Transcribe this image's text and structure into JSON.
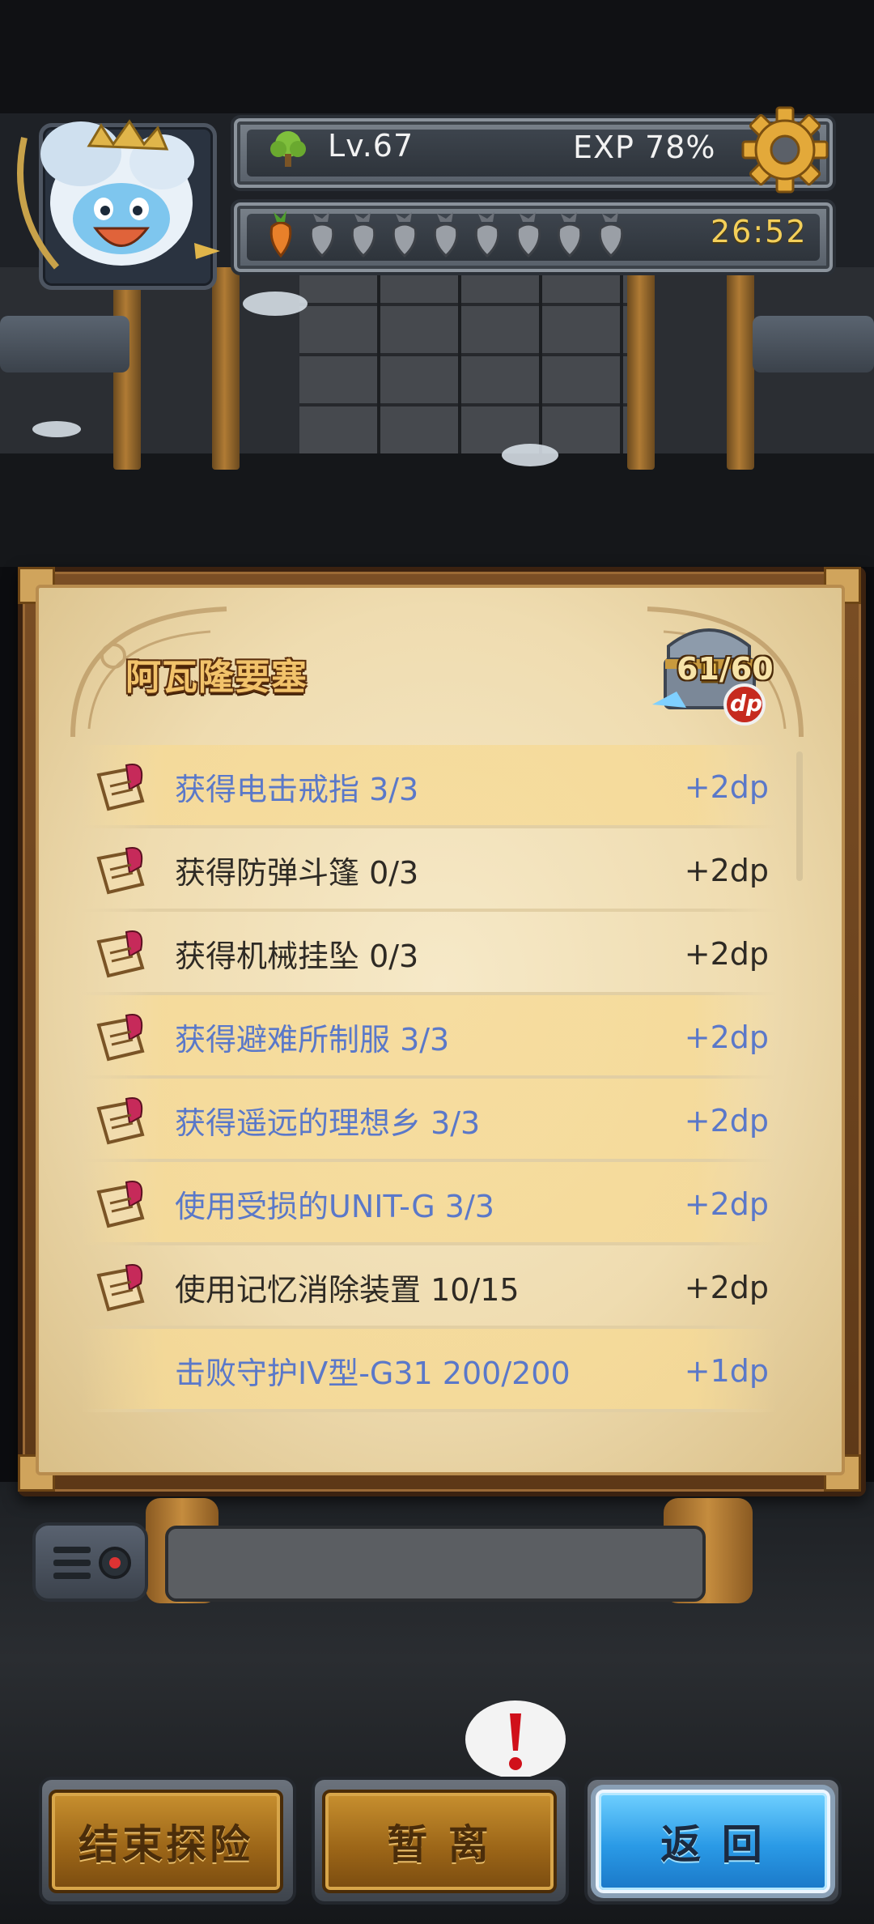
{
  "hud": {
    "level": "Lv.67",
    "exp": "EXP 78%",
    "stamina_filled": 1,
    "stamina_total": 9,
    "timer": "26:52",
    "icons": [
      "avatar",
      "level-tree-icon",
      "gear-icon",
      "carrot-icon",
      "stamina-bag-icon"
    ]
  },
  "panel": {
    "title": "阿瓦隆要塞",
    "chest_count": "61/60",
    "chest_badge": "dp",
    "quests": [
      {
        "label": "获得电击戒指 3/3",
        "reward": "+2dp",
        "done": true
      },
      {
        "label": "获得防弹斗篷 0/3",
        "reward": "+2dp",
        "done": false
      },
      {
        "label": "获得机械挂坠 0/3",
        "reward": "+2dp",
        "done": false
      },
      {
        "label": "获得避难所制服 3/3",
        "reward": "+2dp",
        "done": true
      },
      {
        "label": "获得遥远的理想乡 3/3",
        "reward": "+2dp",
        "done": true
      },
      {
        "label": "使用受损的UNIT-G 3/3",
        "reward": "+2dp",
        "done": true
      },
      {
        "label": "使用记忆消除装置 10/15",
        "reward": "+2dp",
        "done": false
      },
      {
        "label": "击败守护IV型-G31 200/200",
        "reward": "+1dp",
        "done": true,
        "no_icon": true
      }
    ]
  },
  "chat": {
    "message": ""
  },
  "buttons": {
    "end_label": "结束探险",
    "away_label": "暂 离",
    "back_label": "返 回"
  },
  "colors": {
    "done_text": "#5a78c9",
    "normal_text": "#2e2a24",
    "title_gold": "#f2c36b",
    "timer_gold": "#f4d05a"
  }
}
